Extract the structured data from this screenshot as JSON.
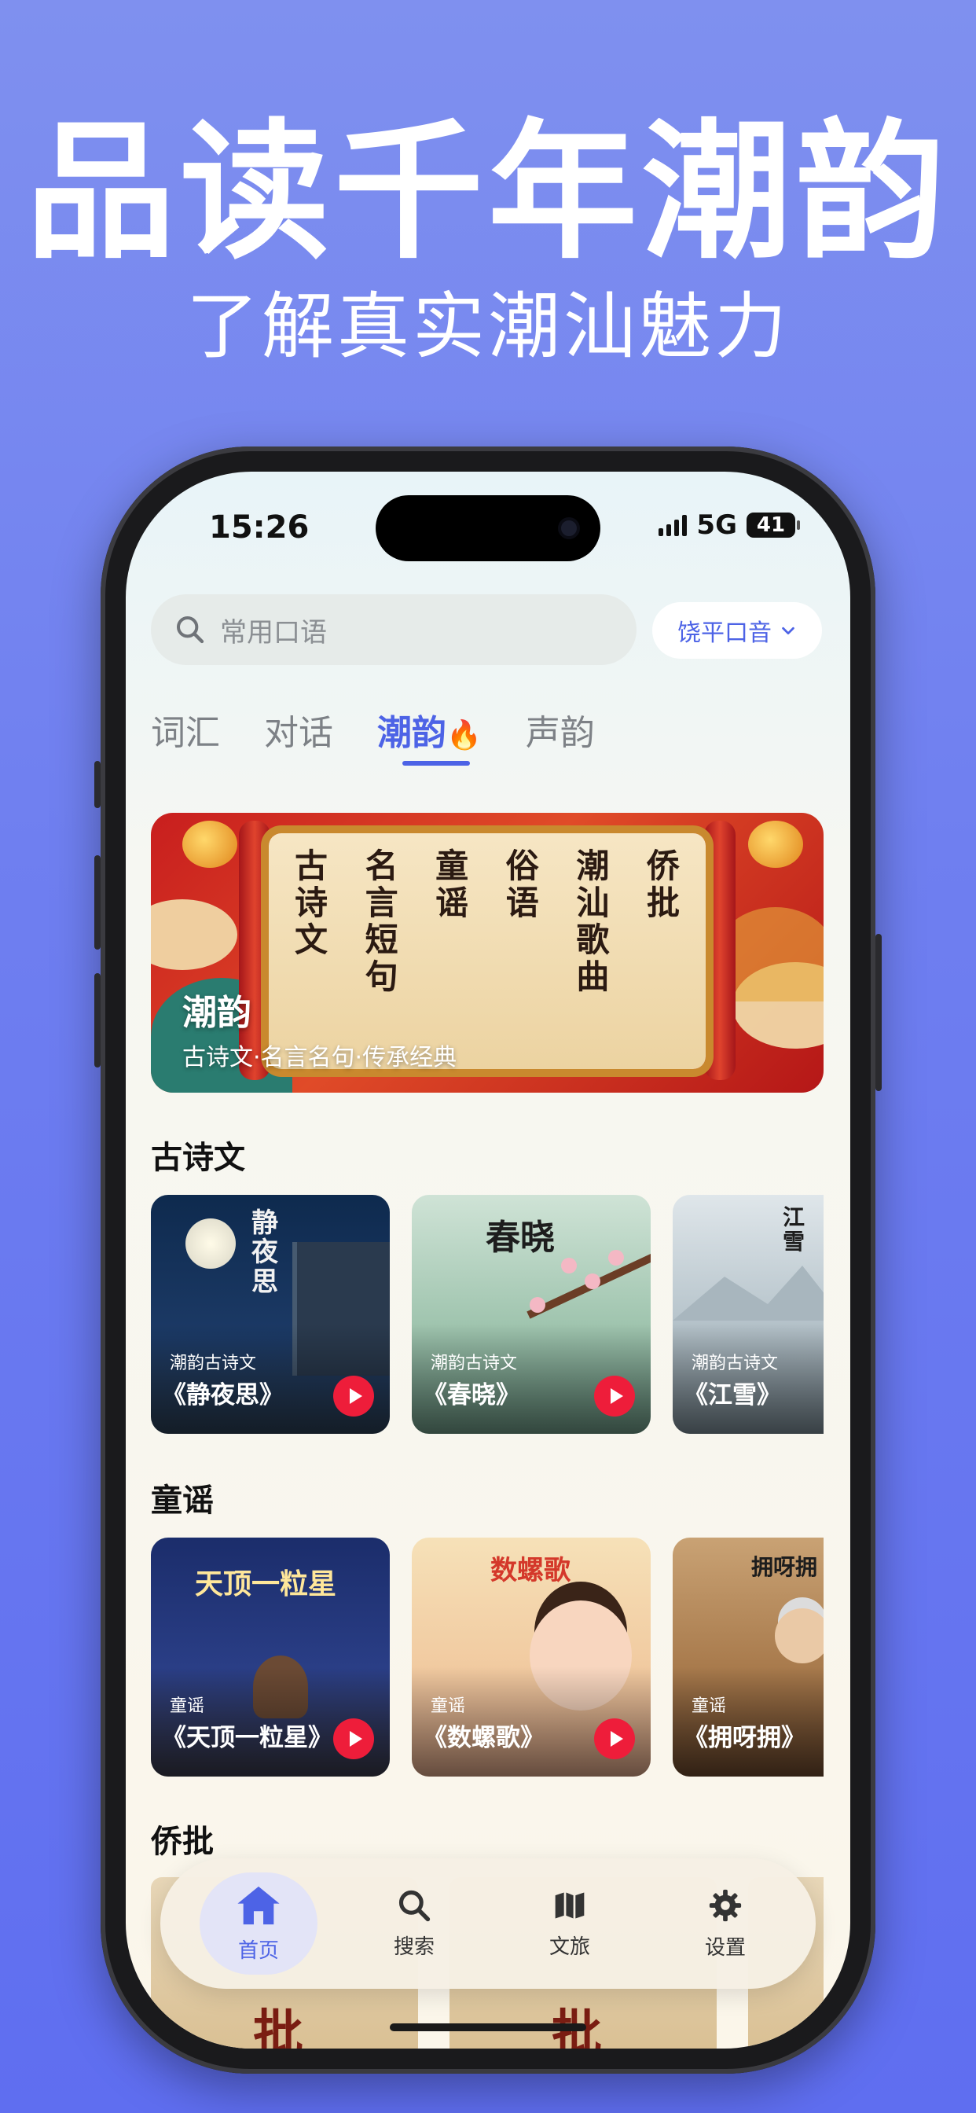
{
  "promo": {
    "headline": "品读千年潮韵",
    "subheadline": "了解真实潮汕魅力"
  },
  "status_bar": {
    "time": "15:26",
    "network": "5G",
    "battery": "41"
  },
  "search": {
    "placeholder": "常用口语",
    "icon": "search-icon"
  },
  "accent_selector": {
    "label": "饶平口音",
    "icon": "chevron-down-icon"
  },
  "tabs": [
    {
      "label": "词汇"
    },
    {
      "label": "对话"
    },
    {
      "label": "潮韵",
      "icon": "fire-icon",
      "active": true
    },
    {
      "label": "声韵"
    }
  ],
  "banner": {
    "title": "潮韵",
    "subtitle": "古诗文·名言名句·传承经典",
    "scroll_columns": [
      "侨批",
      "潮汕歌曲",
      "俗语",
      "童谣",
      "名言短句",
      "古诗文"
    ]
  },
  "sections": [
    {
      "title": "古诗文",
      "cards": [
        {
          "category": "潮韵古诗文",
          "name": "《静夜思》",
          "art_title": "静夜思"
        },
        {
          "category": "潮韵古诗文",
          "name": "《春晓》",
          "art_title": "春晓"
        },
        {
          "category": "潮韵古诗文",
          "name": "《江雪》",
          "art_title": "江雪"
        }
      ]
    },
    {
      "title": "童谣",
      "cards": [
        {
          "category": "童谣",
          "name": "《天顶一粒星》",
          "art_title": "天顶一粒星"
        },
        {
          "category": "童谣",
          "name": "《数螺歌》",
          "art_title": "数螺歌"
        },
        {
          "category": "童谣",
          "name": "《拥呀拥》",
          "art_title": "拥呀拥"
        }
      ]
    },
    {
      "title": "侨批",
      "cards": [
        {
          "art_title": "批"
        },
        {
          "art_title": "批"
        }
      ]
    }
  ],
  "tab_bar": [
    {
      "label": "首页",
      "icon": "home-icon",
      "active": true
    },
    {
      "label": "搜索",
      "icon": "search-icon"
    },
    {
      "label": "文旅",
      "icon": "map-icon"
    },
    {
      "label": "设置",
      "icon": "gear-icon"
    }
  ],
  "colors": {
    "accent": "#4d63e6",
    "play_button": "#ee1d3a",
    "background_top": "#7f90ef",
    "background_bottom": "#5f6ef0"
  }
}
